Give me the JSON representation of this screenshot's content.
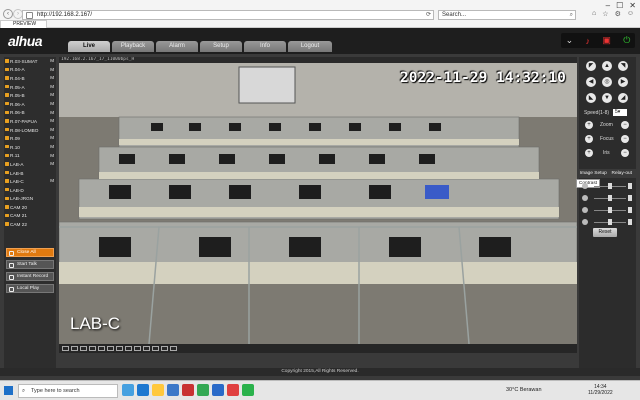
{
  "browser": {
    "url": "http://192.168.2.167/",
    "search_placeholder": "Search...",
    "tab_title": "PREVIEW",
    "back_icon": "back-arrow-icon",
    "forward_icon": "forward-arrow-icon"
  },
  "app": {
    "logo": "alhua",
    "nav_tabs": [
      "Live",
      "Playback",
      "Alarm",
      "Setup",
      "Info",
      "Logout"
    ],
    "active_tab": "Live",
    "header_icons": [
      "chevron-down-icon",
      "mic-off-icon",
      "camera-icon",
      "power-icon"
    ]
  },
  "sidebar": {
    "cameras": [
      {
        "label": "R.03-SUMAT",
        "mark": "M"
      },
      {
        "label": "R.04-A",
        "mark": "M"
      },
      {
        "label": "R.04-B",
        "mark": "M"
      },
      {
        "label": "R.05-A",
        "mark": "M"
      },
      {
        "label": "R.05-B",
        "mark": "M"
      },
      {
        "label": "R.06-A",
        "mark": "M"
      },
      {
        "label": "R.06-B",
        "mark": "M"
      },
      {
        "label": "R.07-PAPUA",
        "mark": "M"
      },
      {
        "label": "R.08-LOMBO",
        "mark": "M"
      },
      {
        "label": "R.09",
        "mark": "M"
      },
      {
        "label": "R.10",
        "mark": "M"
      },
      {
        "label": "R.11",
        "mark": "M"
      },
      {
        "label": "LAB-A",
        "mark": "M"
      },
      {
        "label": "LAB-B",
        "mark": ""
      },
      {
        "label": "LAB-C",
        "mark": "M"
      },
      {
        "label": "LAB-D",
        "mark": ""
      },
      {
        "label": "LAB-JRGN",
        "mark": ""
      },
      {
        "label": "CAM 20",
        "mark": ""
      },
      {
        "label": "CAM 21",
        "mark": ""
      },
      {
        "label": "CAM 22",
        "mark": ""
      }
    ],
    "buttons": [
      {
        "label": "Close All",
        "style": "orange"
      },
      {
        "label": "Start Talk",
        "style": "normal"
      },
      {
        "label": "Instant Record",
        "style": "normal"
      },
      {
        "label": "Local Play",
        "style": "normal"
      }
    ]
  },
  "video": {
    "stream_info": "192.168.2.167_17_11000bps_H",
    "timestamp": "2022-11-29 14:32:10",
    "camera_label": "LAB-C"
  },
  "ptz": {
    "speed_label": "Speed(1-8)",
    "speed_value": "5",
    "zoom_label": "Zoom",
    "focus_label": "Focus",
    "iris_label": "Iris"
  },
  "image_setup": {
    "tabs": [
      "Image Setup",
      "Relay-out"
    ],
    "tooltip": "Contrast",
    "slider_icons": [
      "brightness-icon",
      "contrast-icon",
      "saturation-icon",
      "hue-icon"
    ],
    "reset_label": "Reset"
  },
  "footer": {
    "copyright": "Copyright 2015,All Rights Reserved."
  },
  "taskbar": {
    "search_placeholder": "Type here to search",
    "weather": "30°C  Berawan",
    "time": "14:34",
    "date": "11/29/2022"
  }
}
